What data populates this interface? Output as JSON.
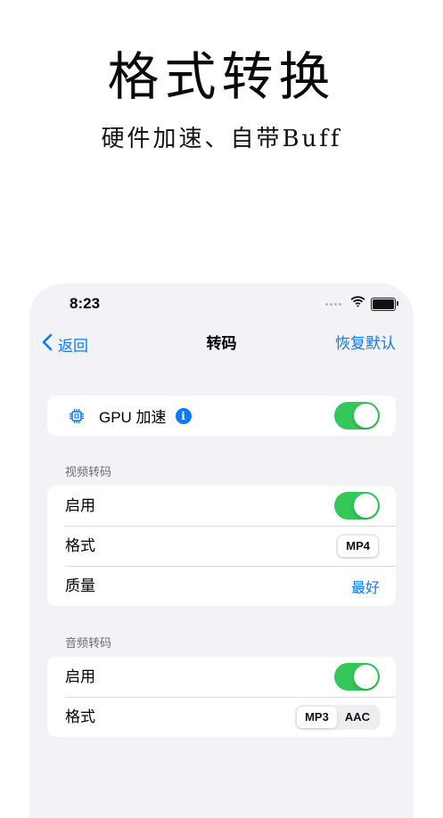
{
  "promo": {
    "title": "格式转换",
    "subtitle": "硬件加速、自带Buff"
  },
  "status_bar": {
    "time": "8:23"
  },
  "nav": {
    "back_label": "返回",
    "title": "转码",
    "reset_label": "恢复默认"
  },
  "gpu_group": {
    "label": "GPU 加速",
    "info_glyph": "i",
    "toggle_on": true
  },
  "video_section": {
    "header": "视频转码",
    "enable_label": "启用",
    "enable_on": true,
    "format_label": "格式",
    "format_options": [
      "MP4"
    ],
    "format_selected": "MP4",
    "quality_label": "质量",
    "quality_value": "最好"
  },
  "audio_section": {
    "header": "音频转码",
    "enable_label": "启用",
    "enable_on": true,
    "format_label": "格式",
    "format_options": [
      "MP3",
      "AAC"
    ],
    "format_option_0": "MP3",
    "format_option_1": "AAC",
    "format_selected": "MP3"
  },
  "colors": {
    "accent": "#0a7aff",
    "toggle_on": "#34c759",
    "background": "#f2f2f7"
  },
  "icons": [
    "chevron-left-icon",
    "wifi-icon",
    "battery-icon",
    "cpu-chip-icon",
    "info-icon"
  ]
}
